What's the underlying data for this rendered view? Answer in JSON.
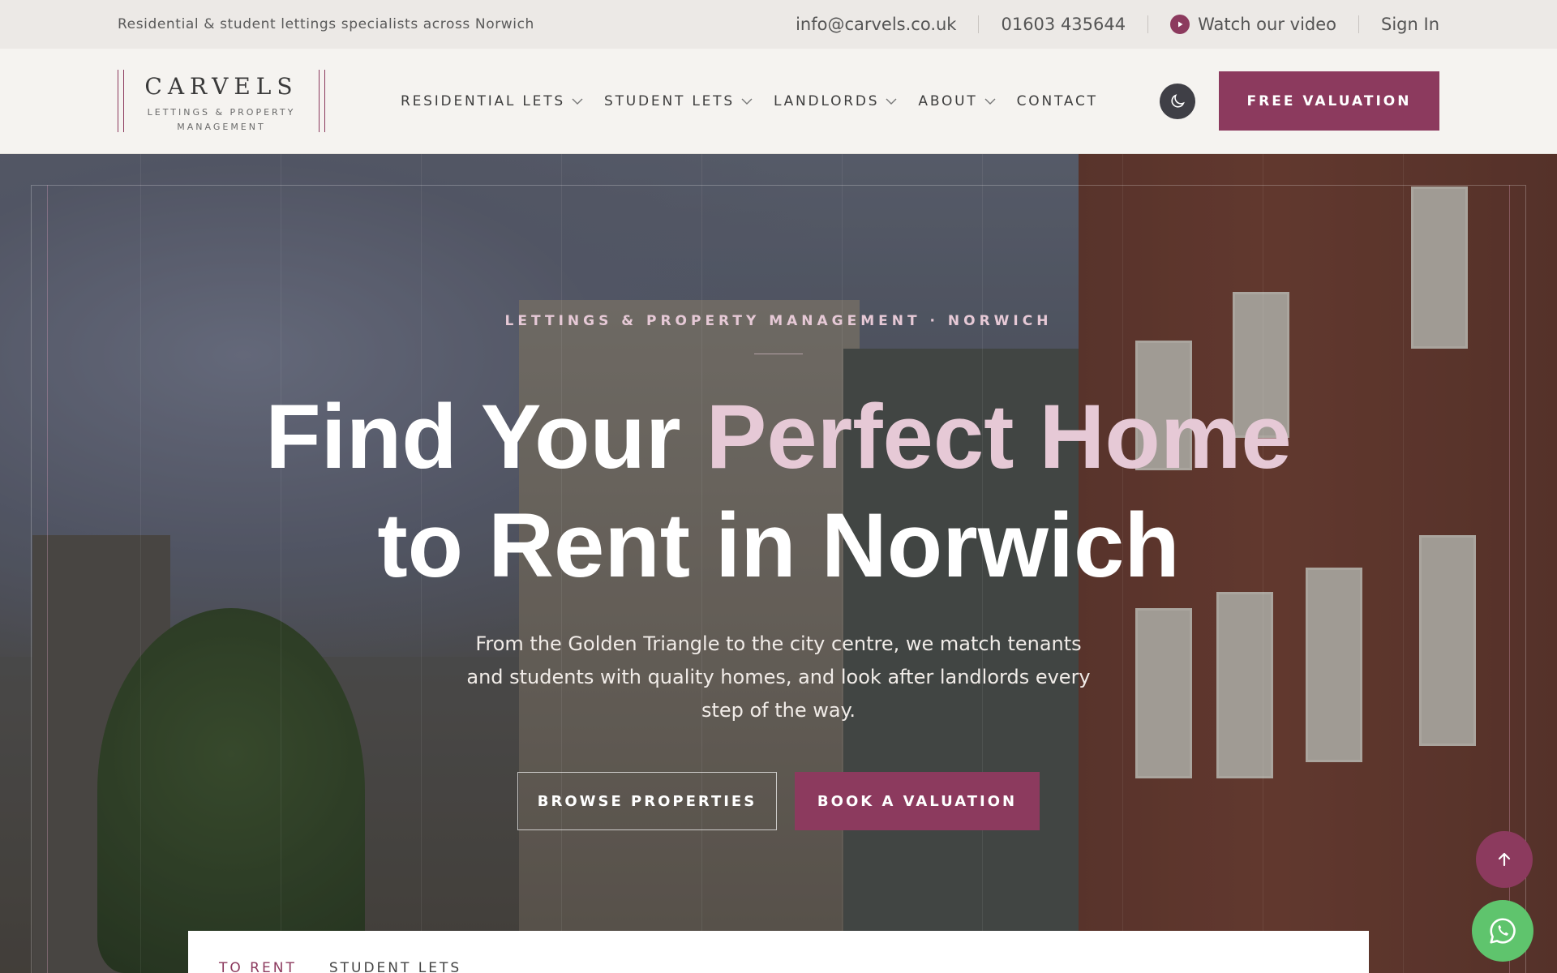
{
  "topbar": {
    "tagline": "Residential & student lettings specialists across Norwich",
    "email": "info@carvels.co.uk",
    "phone": "01603 435644",
    "video_label": "Watch our video",
    "signin_label": "Sign In",
    "play_icon": "play-icon"
  },
  "header": {
    "logo_name": "CARVELS",
    "logo_sub": "LETTINGS & PROPERTY MANAGEMENT",
    "nav": [
      {
        "label": "RESIDENTIAL LETS"
      },
      {
        "label": "STUDENT LETS"
      },
      {
        "label": "LANDLORDS"
      },
      {
        "label": "ABOUT"
      },
      {
        "label": "CONTACT"
      }
    ],
    "theme_icon": "moon-icon",
    "cta_label": "FREE VALUATION"
  },
  "hero": {
    "eyebrow": "LETTINGS & PROPERTY MANAGEMENT · NORWICH",
    "title_part1": "Find Your ",
    "title_accent": "Perfect Home",
    "title_line2": "to Rent in Norwich",
    "lede": "From the Golden Triangle to the city centre, we match tenants and students with quality homes, and look after landlords every step of the way.",
    "btn_browse": "BROWSE PROPERTIES",
    "btn_book": "BOOK A VALUATION"
  },
  "search": {
    "tabs": [
      {
        "label": "TO RENT"
      },
      {
        "label": "STUDENT LETS"
      }
    ]
  },
  "colors": {
    "brand": "#8c3a5e",
    "accent_pink": "#e6c9d6",
    "whatsapp": "#5fc46d"
  },
  "icons": {
    "back_to_top": "arrow-up-icon",
    "whatsapp": "whatsapp-icon"
  }
}
